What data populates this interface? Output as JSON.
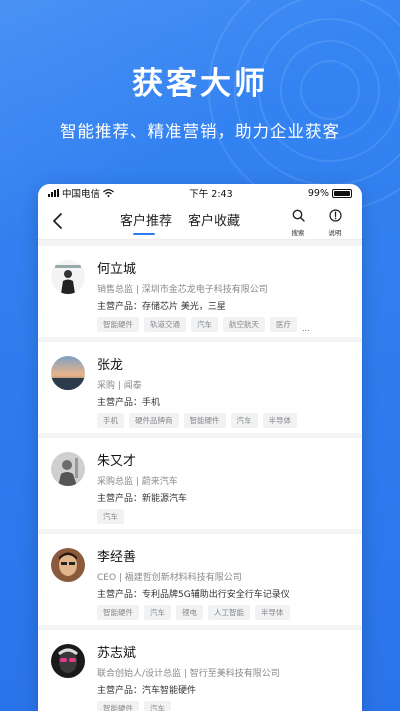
{
  "hero": {
    "title": "获客大师",
    "subtitle": "智能推荐、精准营销，助力企业获客"
  },
  "statusbar": {
    "carrier": "中国电信",
    "time": "下午 2:43",
    "battery": "99%",
    "battery_level": 0.99
  },
  "navbar": {
    "tabs": [
      "客户推荐",
      "客户收藏"
    ],
    "active_tab": 0,
    "search_label": "搜索",
    "info_label": "说明"
  },
  "colors": {
    "accent": "#2f7cf0",
    "background": "#2f7cf0"
  },
  "customers": [
    {
      "name": "何立城",
      "title": "销售总监 | 深圳市金芯龙电子科技有限公司",
      "product": "主营产品：存储芯片 美光，三星",
      "tags": [
        "智能硬件",
        "轨道交通",
        "汽车",
        "航空航天",
        "医疗"
      ],
      "more": "..."
    },
    {
      "name": "张龙",
      "title": "采购 | 闻泰",
      "product": "主营产品：手机",
      "tags": [
        "手机",
        "硬件品牌商",
        "智能硬件",
        "汽车",
        "半导体"
      ],
      "more": ""
    },
    {
      "name": "朱又才",
      "title": "采购总监 | 蔚来汽车",
      "product": "主营产品：新能源汽车",
      "tags": [
        "汽车"
      ],
      "more": ""
    },
    {
      "name": "李经善",
      "title": "CEO | 福建哲创新材料科技有限公司",
      "product": "主营产品：专利品牌5G辅助出行安全行车记录仪",
      "tags": [
        "智能硬件",
        "汽车",
        "锂电",
        "人工智能",
        "半导体"
      ],
      "more": ""
    },
    {
      "name": "苏志斌",
      "title": "联合创始人/设计总监 | 智行至美科技有限公司",
      "product": "主营产品：汽车智能硬件",
      "tags": [
        "智能硬件",
        "汽车"
      ],
      "more": ""
    }
  ]
}
